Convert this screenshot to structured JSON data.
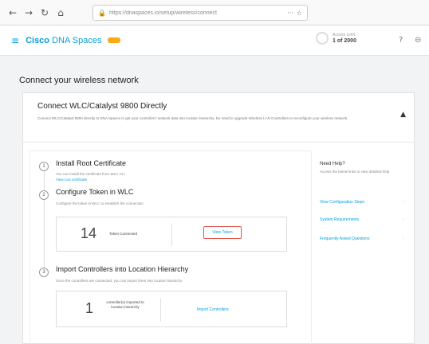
{
  "browser": {
    "back_icon": "arrow-left",
    "forward_icon": "arrow-right",
    "reload_icon": "reload",
    "home_icon": "home",
    "url": "https://dnaspaces.io/setup/wireless/connect",
    "menu_dots": "···",
    "bookmark_icon": "star"
  },
  "header": {
    "brand_prefix": "Cisco",
    "brand_name": "DNA Spaces",
    "badge_color": "#fbab18",
    "account_small": "Access Limit",
    "account_count": "1 of 2000",
    "help_icon": "help-circle",
    "profile_icon": "user"
  },
  "main": {
    "page_title": "Connect your wireless network",
    "card": {
      "title": "Connect WLC/Catalyst 9800 Directly",
      "description": "Connect WLC/Catalyst 9800 directly to DNA Spaces to get your controllers' network data into location hierarchy. No need to upgrade Wireless LAN Controllers to reconfigure your wireless network."
    },
    "steps": [
      {
        "num": "1",
        "title": "Install Root Certificate",
        "sub": "You can install the certificate from WLC CLI",
        "link": "View root certificate"
      },
      {
        "num": "2",
        "title": "Configure Token in WLC",
        "sub": "Configure the token in WLC to establish the connection",
        "count": "14",
        "count_label": "Token Connected",
        "button": "View Token"
      },
      {
        "num": "3",
        "title": "Import Controllers into Location Hierarchy",
        "sub": "Once the controllers are connected, you can import them into location hierarchy",
        "count": "1",
        "count_label": "controller(s) imported to location hierarchy",
        "button": "Import Controllers"
      }
    ],
    "help": {
      "title": "Need Help?",
      "description": "Access the below links to view detailed help",
      "links": [
        "View Configuration Steps",
        "System Requirements",
        "Frequently Asked Questions"
      ]
    }
  }
}
